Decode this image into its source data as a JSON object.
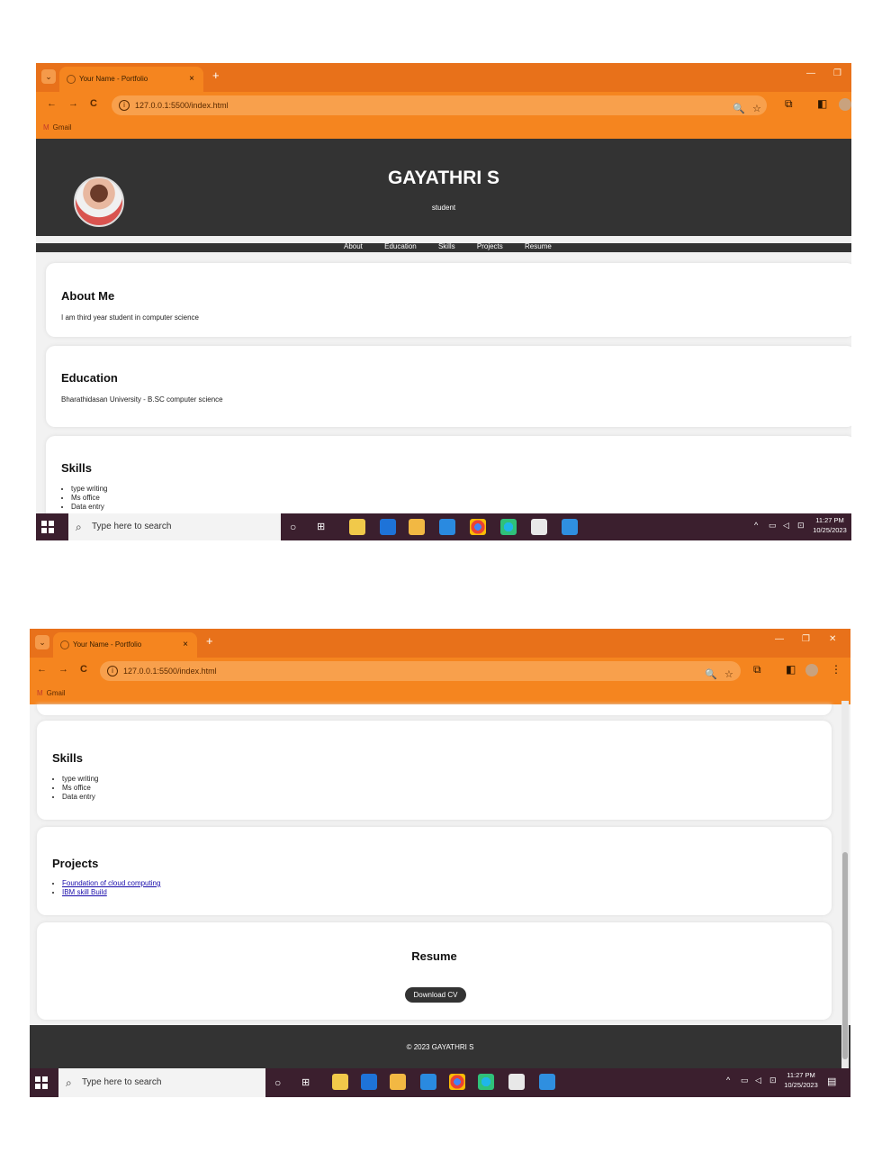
{
  "browser": {
    "tab_title": "Your Name - Portfolio",
    "tab_close": "×",
    "new_tab": "+",
    "url": "127.0.0.1:5500/index.html",
    "bookmark": "Gmail",
    "minimize": "—",
    "restore": "❐",
    "close": "✕",
    "back": "←",
    "forward": "→",
    "reload": "C",
    "zoom_icon": "🔍",
    "star_icon": "☆",
    "menu_icon": "⋮"
  },
  "header": {
    "name": "GAYATHRI S",
    "subtitle": "student"
  },
  "nav": {
    "items": [
      "About",
      "Education",
      "Skills",
      "Projects",
      "Resume"
    ]
  },
  "about": {
    "title": "About Me",
    "text": "I am third year student in computer science"
  },
  "education": {
    "title": "Education",
    "text": "Bharathidasan University - B.SC computer science"
  },
  "skills": {
    "title": "Skills",
    "items": [
      "type writing",
      "Ms office",
      "Data entry"
    ]
  },
  "projects": {
    "title": "Projects",
    "items": [
      "Foundation of cloud computing",
      "IBM skill Build"
    ]
  },
  "resume": {
    "title": "Resume",
    "button": "Download CV"
  },
  "footer": {
    "text": "© 2023 GAYATHRI S"
  },
  "taskbar": {
    "search_placeholder": "Type here to search",
    "time": "11:27 PM",
    "date": "10/25/2023"
  },
  "colors": {
    "chrome_accent": "#f5851f",
    "header_bg": "#333333"
  }
}
